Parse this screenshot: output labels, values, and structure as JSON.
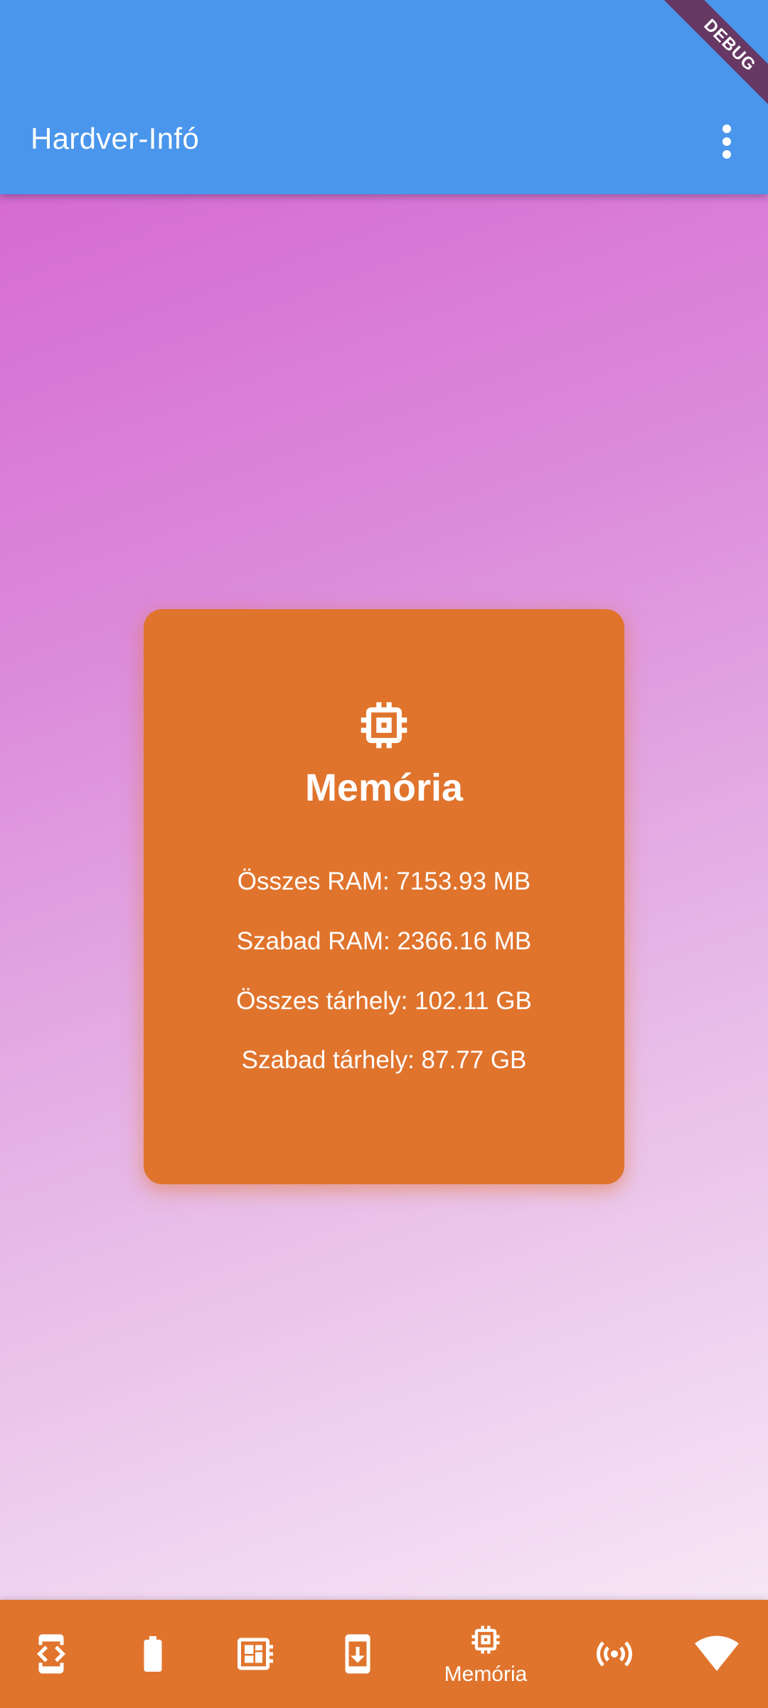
{
  "appbar": {
    "title": "Hardver-Infó",
    "debug_banner": "DEBUG",
    "more_icon": "more-vert-icon"
  },
  "card": {
    "icon": "memory-chip-icon",
    "title": "Memória",
    "lines": [
      "Összes RAM: 7153.93 MB",
      "Szabad RAM: 2366.16 MB",
      "Összes tárhely: 102.11 GB",
      "Szabad tárhely: 87.77 GB"
    ]
  },
  "bottom_nav": {
    "items": [
      {
        "icon": "developer-mode-icon",
        "label": ""
      },
      {
        "icon": "battery-icon",
        "label": ""
      },
      {
        "icon": "dashboard-icon",
        "label": ""
      },
      {
        "icon": "system-update-icon",
        "label": ""
      },
      {
        "icon": "memory-chip-icon",
        "label": "Memória",
        "selected": true
      },
      {
        "icon": "broadcast-icon",
        "label": ""
      },
      {
        "icon": "wifi-icon",
        "label": ""
      }
    ]
  },
  "colors": {
    "appbar": "#4a96ec",
    "accent": "#e0742d",
    "text_on_accent": "#ffffff"
  }
}
